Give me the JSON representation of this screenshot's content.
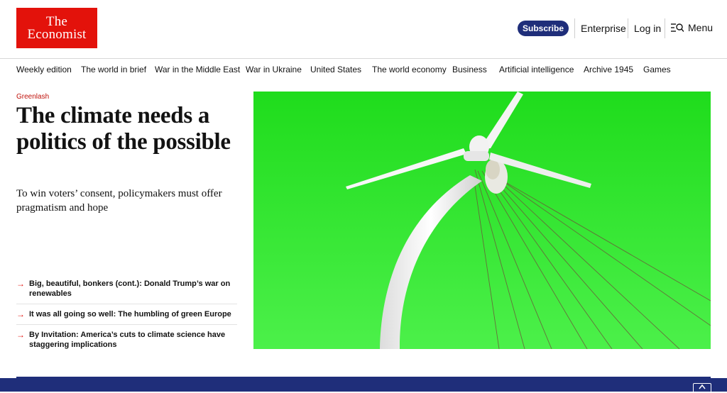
{
  "header": {
    "logo_line1": "The",
    "logo_line2": "Economist",
    "subscribe_label": "Subscribe",
    "enterprise_label": "Enterprise",
    "login_label": "Log in",
    "menu_label": "Menu"
  },
  "nav": {
    "items": [
      "Weekly edition",
      "The world in brief",
      "War in the Middle East",
      "War in Ukraine",
      "United States",
      "The world economy",
      "Business",
      "Artificial intelligence",
      "Archive 1945",
      "Games"
    ]
  },
  "lead": {
    "kicker": "Greenlash",
    "headline": "The climate needs a politics of the possible",
    "dek": "To win voters’ consent, policymakers must offer pragmatism and hope"
  },
  "related": [
    "Big, beautiful, bonkers (cont.): Donald Trump’s war on renewables",
    "It was all going so well: The humbling of green Europe",
    "By Invitation: America’s cuts to climate science have staggering implications"
  ],
  "colors": {
    "brand_red": "#e3120b",
    "navy": "#1f2e7a",
    "hero_green": "#2ee82a"
  },
  "icons": {
    "menu": "search-menu-icon",
    "arrow": "right-arrow-icon",
    "scroll_top": "chevron-up-icon"
  }
}
